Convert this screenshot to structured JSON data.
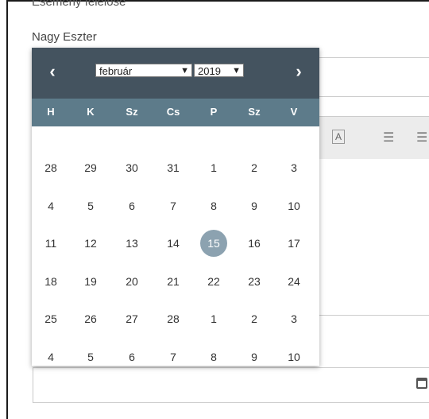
{
  "form": {
    "event_label": "Esemény felelőse",
    "person_name": "Nagy Eszter"
  },
  "toolbar": {
    "text_color_label": "A",
    "list_icon": "☰",
    "list2_icon": "☰"
  },
  "datepicker": {
    "prev_label": "‹",
    "next_label": "›",
    "month_value": "február",
    "year_value": "2019",
    "dropdown_arrow": "▼",
    "weekdays": [
      "H",
      "K",
      "Sz",
      "Cs",
      "P",
      "Sz",
      "V"
    ],
    "weeks": [
      [
        "28",
        "29",
        "30",
        "31",
        "1",
        "2",
        "3"
      ],
      [
        "4",
        "5",
        "6",
        "7",
        "8",
        "9",
        "10"
      ],
      [
        "11",
        "12",
        "13",
        "14",
        "15",
        "16",
        "17"
      ],
      [
        "18",
        "19",
        "20",
        "21",
        "22",
        "23",
        "24"
      ],
      [
        "25",
        "26",
        "27",
        "28",
        "1",
        "2",
        "3"
      ],
      [
        "4",
        "5",
        "6",
        "7",
        "8",
        "9",
        "10"
      ]
    ],
    "selected_day": "15"
  },
  "colors": {
    "header_bg": "#44535f",
    "weekday_bg": "#5d7b8a",
    "selected_bg": "#8ca2b0"
  }
}
